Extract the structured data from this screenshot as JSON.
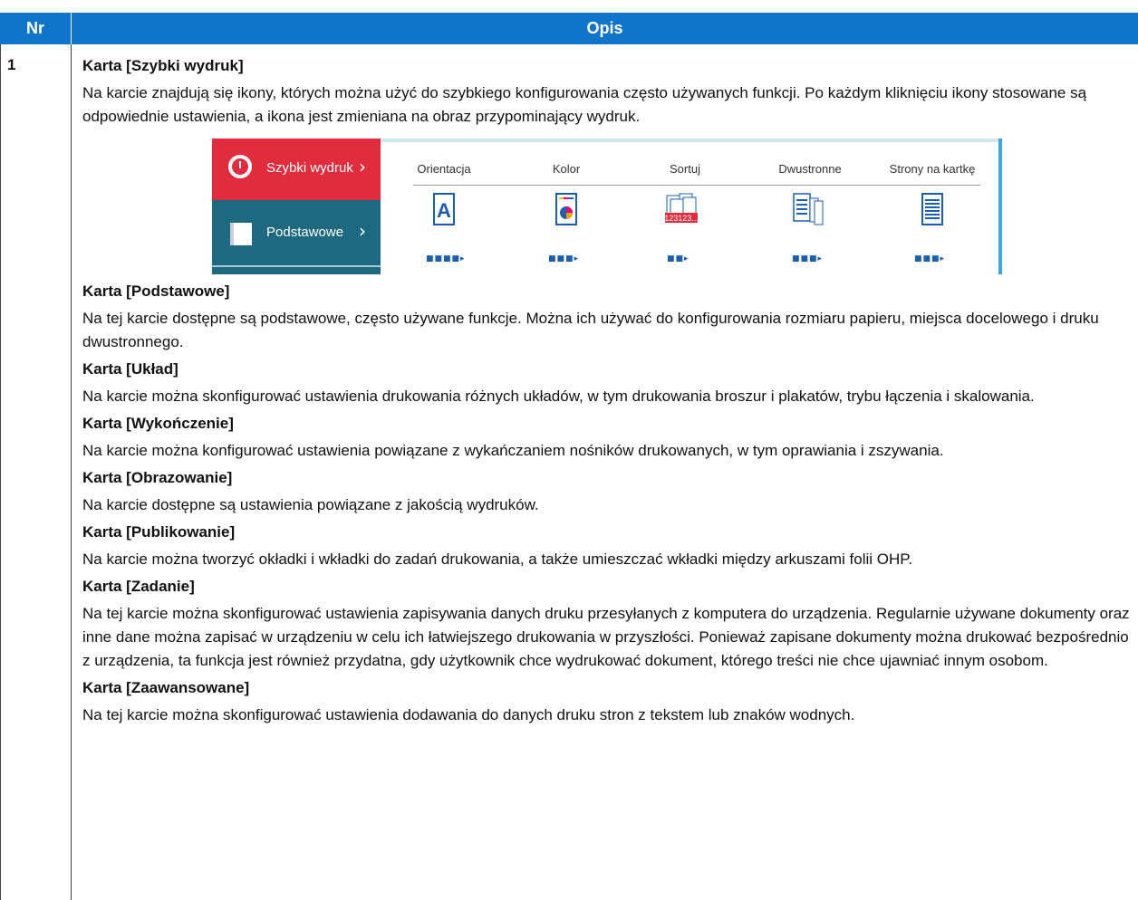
{
  "table": {
    "header": {
      "nr": "Nr",
      "opis": "Opis"
    },
    "row": {
      "nr": "1",
      "sections": [
        {
          "title": "Karta [Szybki wydruk]",
          "body": "Na karcie znajdują się ikony, których można użyć do szybkiego konfigurowania często używanych funkcji. Po każdym kliknięciu ikony stosowane są odpowiednie ustawienia, a ikona jest zmieniana na obraz przypominający wydruk."
        },
        {
          "title": "Karta [Podstawowe]",
          "body": "Na tej karcie dostępne są podstawowe, często używane funkcje. Można ich używać do konfigurowania rozmiaru papieru, miejsca docelowego i druku dwustronnego."
        },
        {
          "title": "Karta [Układ]",
          "body": "Na karcie można skonfigurować ustawienia drukowania różnych układów, w tym drukowania broszur i plakatów, trybu łączenia i skalowania."
        },
        {
          "title": "Karta [Wykończenie]",
          "body": "Na karcie można konfigurować ustawienia powiązane z wykańczaniem nośników drukowanych, w tym oprawiania i zszywania."
        },
        {
          "title": "Karta [Obrazowanie]",
          "body": "Na karcie dostępne są ustawienia powiązane z jakością wydruków."
        },
        {
          "title": "Karta [Publikowanie]",
          "body": "Na karcie można tworzyć okładki i wkładki do zadań drukowania, a także umieszczać wkładki między arkuszami folii OHP."
        },
        {
          "title": "Karta [Zadanie]",
          "body": "Na tej karcie można skonfigurować ustawienia zapisywania danych druku przesyłanych z komputera do urządzenia. Regularnie używane dokumenty oraz inne dane można zapisać w urządzeniu w celu ich łatwiejszego drukowania w przyszłości. Ponieważ zapisane dokumenty można drukować bezpośrednio z urządzenia, ta funkcja jest również przydatna, gdy użytkownik chce wydrukować dokument, którego treści nie chce ujawniać innym osobom."
        },
        {
          "title": "Karta [Zaawansowane]",
          "body": "Na tej karcie można skonfigurować ustawienia dodawania do danych druku stron z tekstem lub znaków wodnych."
        }
      ]
    }
  },
  "screenshot": {
    "tabs": [
      {
        "label": "Szybki wydruk",
        "icon": "stopwatch-icon",
        "color": "#e02c3c"
      },
      {
        "label": "Podstawowe",
        "icon": "book-icon",
        "color": "#1d6a80"
      }
    ],
    "options": [
      {
        "label": "Orientacja",
        "icon": "orientation-icon"
      },
      {
        "label": "Kolor",
        "icon": "color-icon"
      },
      {
        "label": "Sortuj",
        "icon": "collate-icon",
        "overlay": "123123..."
      },
      {
        "label": "Dwustronne",
        "icon": "duplex-icon"
      },
      {
        "label": "Strony na kartkę",
        "icon": "pages-per-sheet-icon"
      }
    ],
    "accent_color": "#39a6e6"
  },
  "colors": {
    "header_bg": "#1074c8"
  }
}
